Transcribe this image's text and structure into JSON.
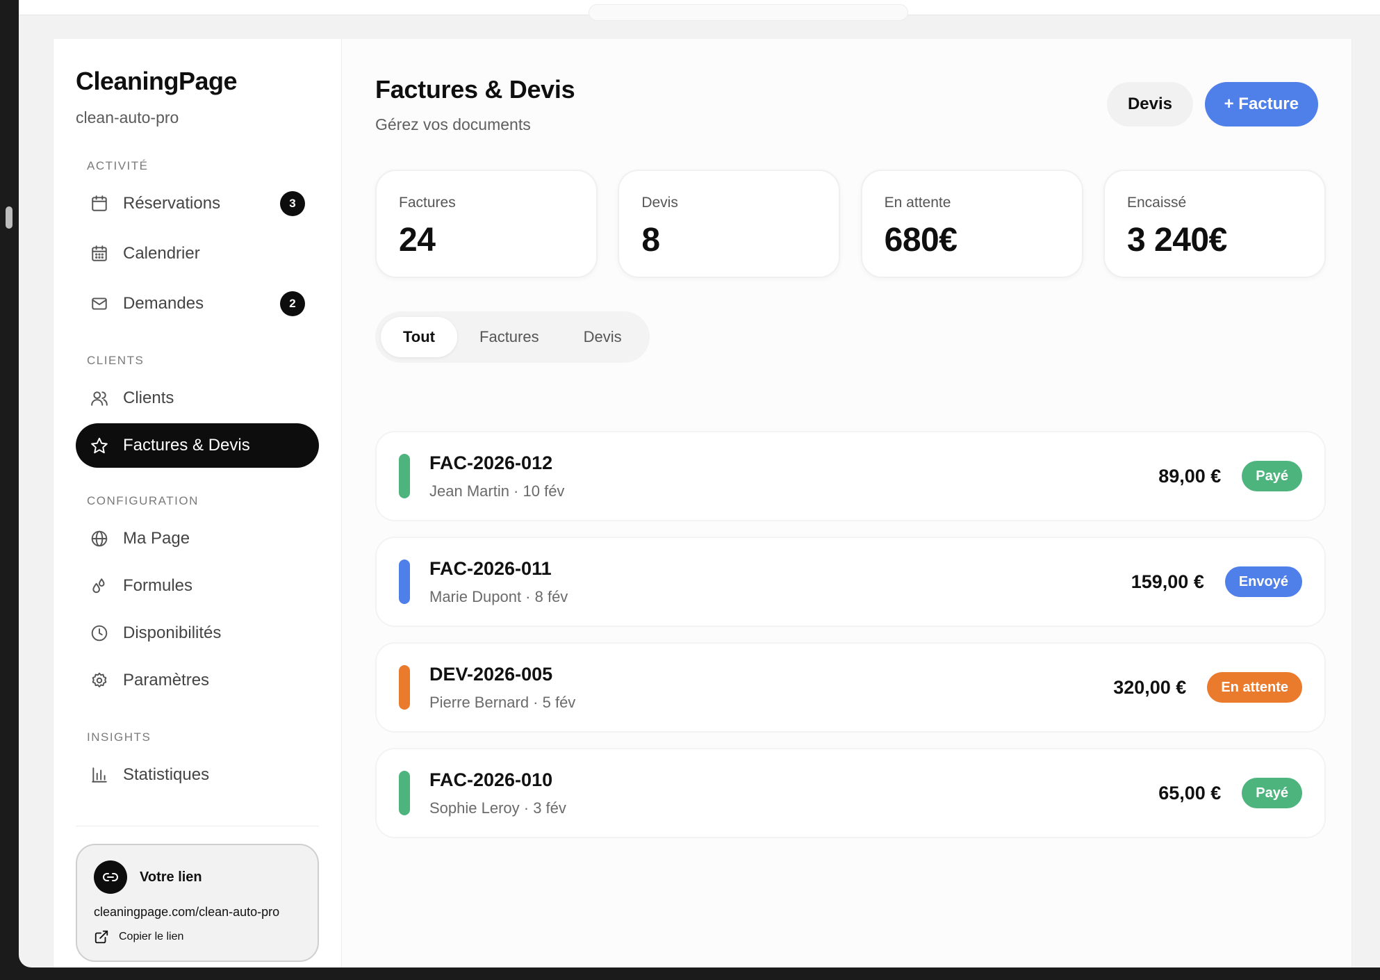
{
  "colors": {
    "accent": "#4f7fe8",
    "paid": "#4db47e",
    "sent": "#4f7fe8",
    "pending": "#ea7a2c",
    "dark": "#0d0d0d"
  },
  "sidebar": {
    "brand": "CleaningPage",
    "slug": "clean-auto-pro",
    "sections": {
      "activity": "ACTIVITÉ",
      "clients": "CLIENTS",
      "configuration": "CONFIGURATION",
      "insights": "INSIGHTS"
    },
    "items": {
      "reservations": {
        "label": "Réservations",
        "icon": "calendar-icon",
        "badge": "3"
      },
      "calendar": {
        "label": "Calendrier",
        "icon": "calendar-grid-icon"
      },
      "requests": {
        "label": "Demandes",
        "icon": "mail-icon",
        "badge": "2"
      },
      "clients": {
        "label": "Clients",
        "icon": "users-icon"
      },
      "invoices": {
        "label": "Factures & Devis",
        "icon": "star-icon"
      },
      "mypage": {
        "label": "Ma Page",
        "icon": "globe-icon"
      },
      "formulas": {
        "label": "Formules",
        "icon": "droplets-icon"
      },
      "availability": {
        "label": "Disponibilités",
        "icon": "clock-icon"
      },
      "settings": {
        "label": "Paramètres",
        "icon": "gear-icon"
      },
      "stats": {
        "label": "Statistiques",
        "icon": "bar-chart-icon"
      }
    },
    "link_card": {
      "title": "Votre lien",
      "url": "cleaningpage.com/clean-auto-pro",
      "copy_label": "Copier le lien"
    }
  },
  "main": {
    "title": "Factures & Devis",
    "subtitle": "Gérez vos documents",
    "btn_devis": "Devis",
    "btn_facture": "+ Facture",
    "stats": [
      {
        "label": "Factures",
        "value": "24"
      },
      {
        "label": "Devis",
        "value": "8"
      },
      {
        "label": "En attente",
        "value": "680€"
      },
      {
        "label": "Encaissé",
        "value": "3 240€"
      }
    ],
    "tabs": [
      "Tout",
      "Factures",
      "Devis"
    ],
    "documents": [
      {
        "id": "FAC-2026-012",
        "meta": "Jean Martin · 10 fév",
        "amount": "89,00 €",
        "status": "Payé"
      },
      {
        "id": "FAC-2026-011",
        "meta": "Marie Dupont · 8 fév",
        "amount": "159,00 €",
        "status": "Envoyé"
      },
      {
        "id": "DEV-2026-005",
        "meta": "Pierre Bernard · 5 fév",
        "amount": "320,00 €",
        "status": "En attente"
      },
      {
        "id": "FAC-2026-010",
        "meta": "Sophie Leroy · 3 fév",
        "amount": "65,00 €",
        "status": "Payé"
      }
    ]
  }
}
